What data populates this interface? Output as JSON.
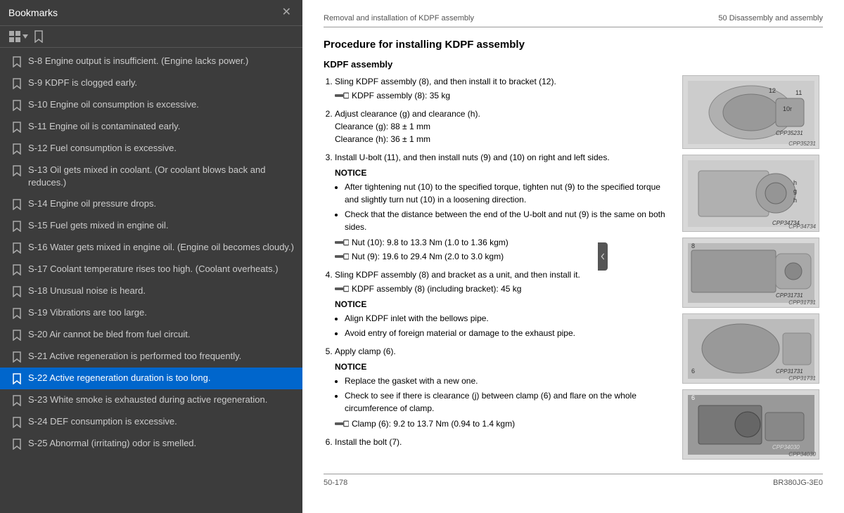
{
  "left_panel": {
    "title": "Bookmarks",
    "toolbar": {
      "grid_btn": "⊞",
      "bookmark_btn": "🔖"
    },
    "items": [
      {
        "id": "s8",
        "label": "S-8 Engine output is insufficient. (Engine lacks power.)",
        "active": false
      },
      {
        "id": "s9",
        "label": "S-9 KDPF is clogged early.",
        "active": false
      },
      {
        "id": "s10",
        "label": "S-10 Engine oil consumption is excessive.",
        "active": false
      },
      {
        "id": "s11",
        "label": "S-11 Engine oil is contaminated early.",
        "active": false
      },
      {
        "id": "s12",
        "label": "S-12 Fuel consumption is excessive.",
        "active": false
      },
      {
        "id": "s13",
        "label": "S-13 Oil gets mixed in coolant. (Or coolant blows back and reduces.)",
        "active": false
      },
      {
        "id": "s14",
        "label": "S-14 Engine oil pressure drops.",
        "active": false
      },
      {
        "id": "s15",
        "label": "S-15 Fuel gets mixed in engine oil.",
        "active": false
      },
      {
        "id": "s16",
        "label": "S-16 Water gets mixed in engine oil. (Engine oil becomes cloudy.)",
        "active": false
      },
      {
        "id": "s17",
        "label": "S-17 Coolant temperature rises too high. (Coolant overheats.)",
        "active": false
      },
      {
        "id": "s18",
        "label": "S-18 Unusual noise is heard.",
        "active": false
      },
      {
        "id": "s19",
        "label": "S-19 Vibrations are too large.",
        "active": false
      },
      {
        "id": "s20",
        "label": "S-20 Air cannot be bled from fuel circuit.",
        "active": false
      },
      {
        "id": "s21",
        "label": "S-21 Active regeneration is performed too frequently.",
        "active": false
      },
      {
        "id": "s22",
        "label": "S-22 Active regeneration duration is too long.",
        "active": true
      },
      {
        "id": "s23",
        "label": "S-23 White smoke is exhausted during active regeneration.",
        "active": false
      },
      {
        "id": "s24",
        "label": "S-24 DEF consumption is excessive.",
        "active": false
      },
      {
        "id": "s25",
        "label": "S-25 Abnormal (irritating) odor is smelled.",
        "active": false
      }
    ]
  },
  "right_panel": {
    "header_left": "Removal and installation of KDPF assembly",
    "header_right": "50 Disassembly and assembly",
    "doc_title": "Procedure for installing KDPF assembly",
    "doc_subtitle": "KDPF assembly",
    "steps": [
      {
        "num": 1,
        "text": "Sling KDPF assembly (8), and then install it to bracket (12).",
        "torque": "KDPF assembly (8): 35 kg"
      },
      {
        "num": 2,
        "text": "Adjust clearance (g) and clearance (h).",
        "details": [
          "Clearance (g): 88 ± 1 mm",
          "Clearance (h): 36 ± 1 mm"
        ]
      },
      {
        "num": 3,
        "text": "Install U-bolt (11), and then install nuts (9) and (10) on right and left sides.",
        "notice_label": "NOTICE",
        "notices": [
          "After tightening nut (10) to the specified torque, tighten nut (9) to the specified torque and slightly turn nut (10) in a loosening direction.",
          "Check that the distance between the end of the U-bolt and nut (9) is the same on both sides."
        ],
        "torques": [
          "Nut (10): 9.8 to 13.3 Nm (1.0 to 1.36 kgm)",
          "Nut (9): 19.6 to 29.4 Nm (2.0 to 3.0 kgm)"
        ]
      },
      {
        "num": 4,
        "text": "Sling KDPF assembly (8) and bracket as a unit, and then install it.",
        "torque": "KDPF assembly (8) (including bracket): 45 kg",
        "notice_label": "NOTICE",
        "notices": [
          "Align KDPF inlet with the bellows pipe.",
          "Avoid entry of foreign material or damage to the exhaust pipe."
        ]
      },
      {
        "num": 5,
        "text": "Apply clamp (6).",
        "notice_label": "NOTICE",
        "notices": [
          "Replace the gasket with a new one.",
          "Check to see if there is clearance (j) between clamp (6) and flare on the whole circumference of clamp."
        ],
        "torques": [
          "Clamp (6): 9.2 to 13.7 Nm (0.94 to 1.4 kgm)"
        ]
      },
      {
        "num": 6,
        "text": "Install the bolt (7)."
      }
    ],
    "images": [
      {
        "caption": "CPP35231",
        "label": "11, 10, 12, g"
      },
      {
        "caption": "CPP34734",
        "label": "h, g"
      },
      {
        "caption": "CPP31731",
        "label": "8"
      },
      {
        "caption": "CPP31731",
        "label": "6"
      },
      {
        "caption": "CPP34030",
        "label": "6, 7"
      }
    ],
    "footer_left": "50-178",
    "footer_right": "BR380JG-3E0"
  },
  "collapse_icon": "◀"
}
